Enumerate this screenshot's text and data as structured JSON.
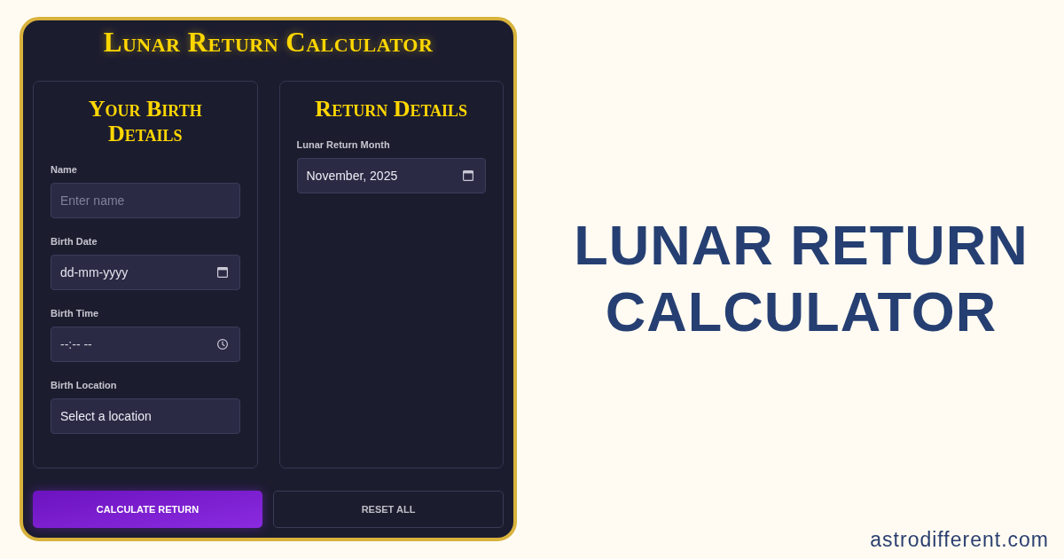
{
  "calculator": {
    "title": "Lunar Return Calculator",
    "panels": [
      {
        "title": "Your Birth Details",
        "fields": [
          {
            "label": "Name",
            "kind": "text",
            "placeholder": "Enter name"
          },
          {
            "label": "Birth Date",
            "kind": "date",
            "placeholder": "dd-mm-yyyy"
          },
          {
            "label": "Birth Time",
            "kind": "time",
            "placeholder": "--:-- --"
          },
          {
            "label": "Birth Location",
            "kind": "select",
            "value": "Select a location"
          }
        ]
      },
      {
        "title": "Return Details",
        "fields": [
          {
            "label": "Lunar Return Month",
            "kind": "month",
            "value": "November, 2025"
          }
        ]
      }
    ],
    "buttons": [
      {
        "label": "CALCULATE RETURN",
        "kind": "primary"
      },
      {
        "label": "RESET ALL",
        "kind": "secondary"
      }
    ]
  },
  "headline": "LUNAR RETURN CALCULATOR",
  "site": "astrodifferent.com"
}
